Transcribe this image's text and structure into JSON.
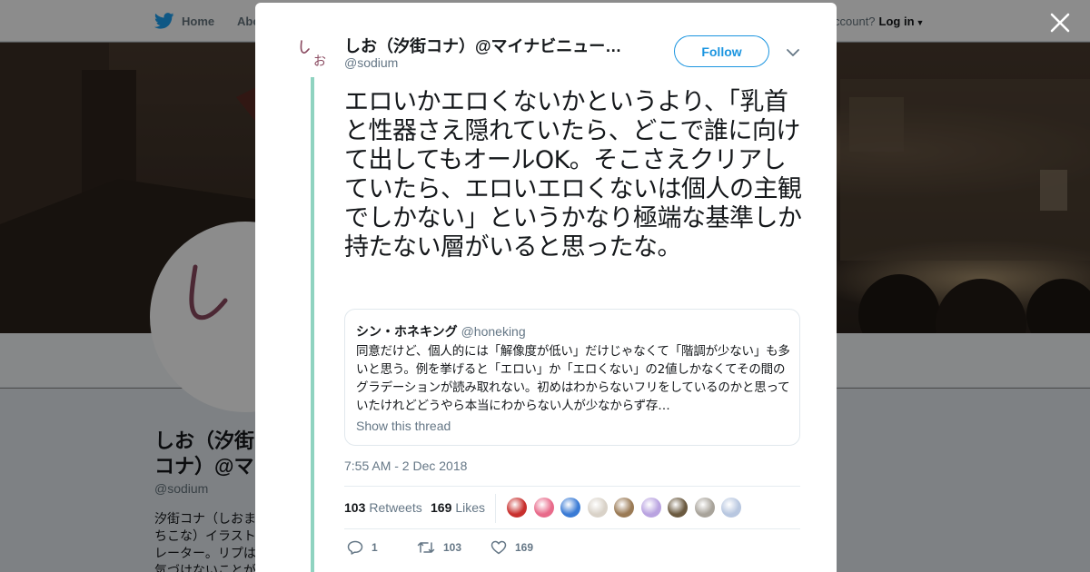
{
  "background_page": {
    "nav": {
      "home_label": "Home",
      "about_label": "Abo",
      "have_account_text": "ccount?",
      "login_label": "Log in"
    },
    "profile": {
      "name": "しお（汐街コナ）@マイナビニュースで",
      "handle": "@sodium",
      "bio": "汐街コナ（しおまちこな）イラストレーター。リプは気づけないことが多いので、ご用の方はHP…『「死ぬくらいなら会社辞めれば」ができない理由』"
    }
  },
  "modal": {
    "close_label": "×",
    "author": {
      "name": "しお（汐街コナ）@マイナビニュー…",
      "handle": "@sodium",
      "avatar_text": "しお"
    },
    "follow_label": "Follow",
    "tweet_text": "エロいかエロくないかというより、「乳首と性器さえ隠れていたら、どこで誰に向けて出してもオールOK。そこさえクリアしていたら、エロいエロくないは個人の主観でしかない」というかなり極端な基準しか持たない層がいると思ったな。",
    "quoted": {
      "name": "シン・ホネキング",
      "handle": "@honeking",
      "text": "同意だけど、個人的には「解像度が低い」だけじゃなくて「階調が少ない」も多いと思う。例を挙げると「エロい」か「エロくない」の2値しかなくてその間のグラデーションが読み取れない。初めはわからないフリをしているのかと思っていたけれどどうやら本当にわからない人が少なからず存…",
      "show_thread_label": "Show this thread"
    },
    "timestamp": "7:55 AM - 2 Dec 2018",
    "stats": {
      "retweets_count": "103",
      "retweets_label": "Retweets",
      "likes_count": "169",
      "likes_label": "Likes"
    },
    "likers": [
      {
        "icon": "liker-avatar-1",
        "color": "#c8302e"
      },
      {
        "icon": "liker-avatar-2",
        "color": "#e86a8a"
      },
      {
        "icon": "liker-avatar-3",
        "color": "#3a7bd5"
      },
      {
        "icon": "liker-avatar-4",
        "color": "#d9d2c8"
      },
      {
        "icon": "liker-avatar-5",
        "color": "#9a7a55"
      },
      {
        "icon": "liker-avatar-6",
        "color": "#b9a3e0"
      },
      {
        "icon": "liker-avatar-7",
        "color": "#6b5a40"
      },
      {
        "icon": "liker-avatar-8",
        "color": "#a8a39a"
      },
      {
        "icon": "liker-avatar-9",
        "color": "#b8c7e0"
      }
    ],
    "actions": {
      "reply_count": "1",
      "retweet_count": "103",
      "like_count": "169"
    }
  },
  "colors": {
    "accent": "#1b95e0",
    "thread_line": "#8fd3c0",
    "twitter_blue": "#1da1f2"
  }
}
